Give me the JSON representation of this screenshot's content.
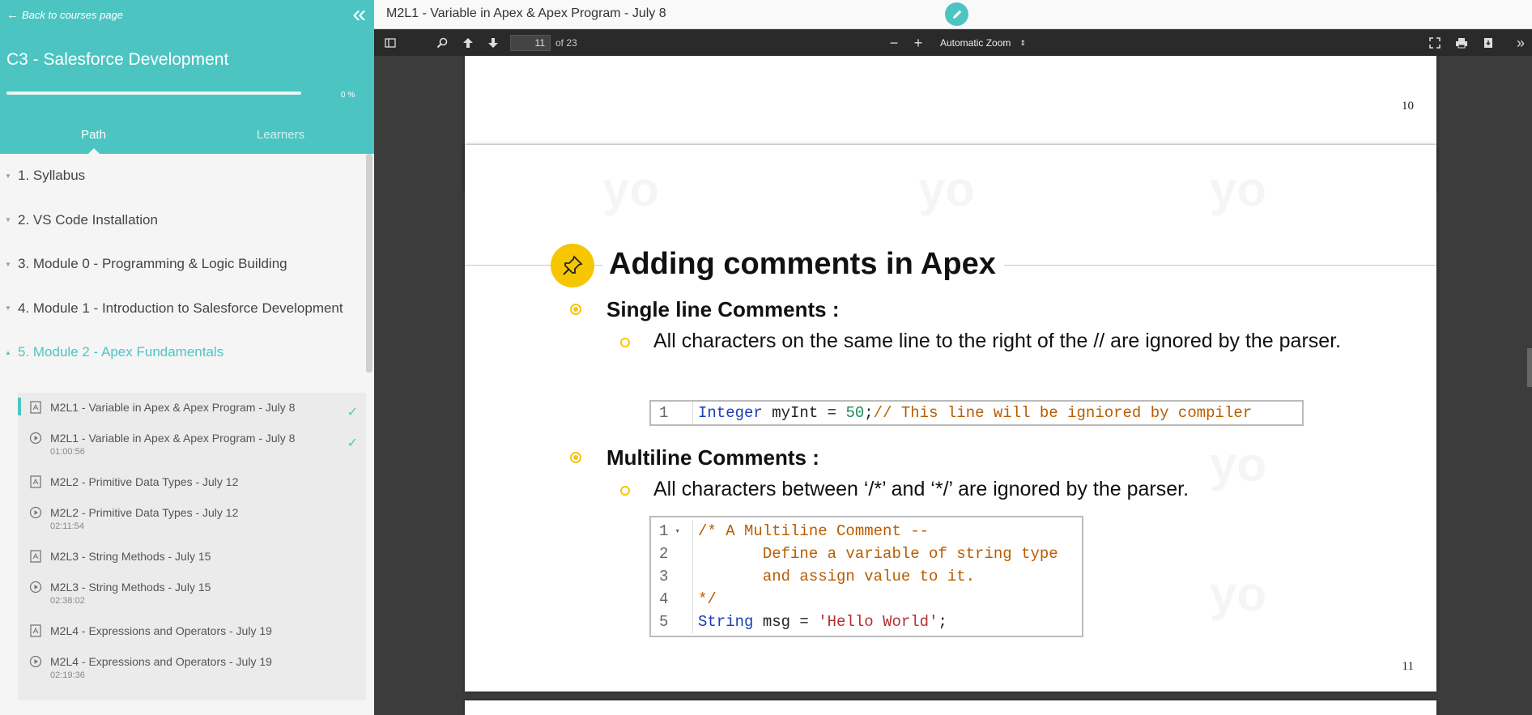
{
  "sidebar": {
    "back_label": "Back to courses page",
    "course_title": "C3 - Salesforce Development",
    "progress_label": "0 %",
    "progress_fraction": 0.0,
    "tabs": [
      {
        "label": "Path",
        "active": true
      },
      {
        "label": "Learners",
        "active": false
      }
    ],
    "modules": [
      {
        "label": "1. Syllabus"
      },
      {
        "label": "2. VS Code Installation"
      },
      {
        "label": "3. Module 0 - Programming & Logic Building"
      },
      {
        "label": "4. Module 1 - Introduction to Salesforce Development"
      },
      {
        "label": "5. Module 2 - Apex Fundamentals"
      }
    ],
    "lessons": [
      {
        "icon": "pdf-icon",
        "title": "M2L1 - Variable in Apex & Apex Program - July 8",
        "duration": "",
        "check": "✓"
      },
      {
        "icon": "play-icon",
        "title": "M2L1 - Variable in Apex & Apex Program - July 8",
        "duration": "01:00:56",
        "check": "✓"
      },
      {
        "icon": "pdf-icon",
        "title": "M2L2 - Primitive Data Types - July 12",
        "duration": "",
        "check": ""
      },
      {
        "icon": "play-icon",
        "title": "M2L2 - Primitive Data Types - July 12",
        "duration": "02:11:54",
        "check": ""
      },
      {
        "icon": "pdf-icon",
        "title": "M2L3 - String Methods - July 15",
        "duration": "",
        "check": ""
      },
      {
        "icon": "play-icon",
        "title": "M2L3 - String Methods - July 15",
        "duration": "02:38:02",
        "check": ""
      },
      {
        "icon": "pdf-icon",
        "title": "M2L4 - Expressions and Operators - July 19",
        "duration": "",
        "check": ""
      },
      {
        "icon": "play-icon",
        "title": "M2L4 - Expressions and Operators - July 19",
        "duration": "02:19:36",
        "check": ""
      }
    ]
  },
  "topbar": {
    "doc_title": "M2L1 - Variable in Apex & Apex Program - July 8"
  },
  "pdf_toolbar": {
    "page_value": "11",
    "page_total": "of 23",
    "zoom_label": "Automatic Zoom"
  },
  "pdf": {
    "prev_page_number": "10",
    "current_page_number": "11",
    "slide_title": "Adding comments in Apex",
    "section1_heading": "Single line Comments :",
    "section1_text": "All characters on the same line to the right of the // are ignored by the parser.",
    "code1": {
      "line_numbers": [
        "1"
      ],
      "line1": {
        "kw": "Integer",
        "txt": " myInt = ",
        "num": "50",
        "semi": ";",
        "cm": "// This line will be igniored by compiler"
      }
    },
    "section2_heading": "Multiline Comments :",
    "section2_text": "All characters between ‘/*’ and ‘*/’ are ignored by the parser.",
    "code2": {
      "line_numbers": [
        "1",
        "2",
        "3",
        "4",
        "5"
      ],
      "fold_marker": "▾",
      "line1": "/* A Multiline Comment --",
      "line2": "       Define a variable of string type",
      "line3": "       and assign value to it.",
      "line4": "*/",
      "line5": {
        "kw": "String",
        "txt": " msg = ",
        "str": "'Hello World'",
        "semi": ";"
      }
    },
    "watermark": "yo"
  },
  "colors": {
    "accent": "#4cc5c2",
    "bullet": "#f6c700"
  }
}
